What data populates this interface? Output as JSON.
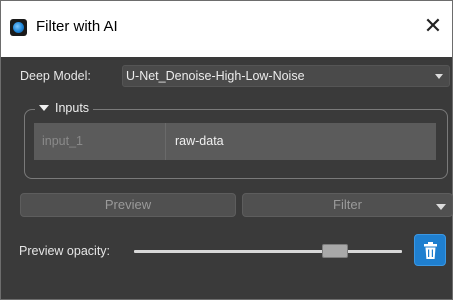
{
  "window": {
    "title": "Filter with AI",
    "close_glyph": "✕",
    "icon": "app-logo-icon"
  },
  "model": {
    "label": "Deep Model:",
    "selected": "U-Net_Denoise-High-Low-Noise"
  },
  "inputs": {
    "section_label": "Inputs",
    "rows": [
      {
        "name": "input_1",
        "value": "raw-data"
      }
    ]
  },
  "actions": {
    "preview_label": "Preview",
    "filter_label": "Filter"
  },
  "preview_opacity": {
    "label": "Preview opacity:",
    "value": 0.75
  },
  "icons": {
    "delete": "trash-icon",
    "dropdown": "chevron-down-icon",
    "collapse": "triangle-down-icon"
  },
  "colors": {
    "background": "#3a3a3a",
    "accent": "#1f7fcf",
    "titlebar": "#ffffff"
  }
}
